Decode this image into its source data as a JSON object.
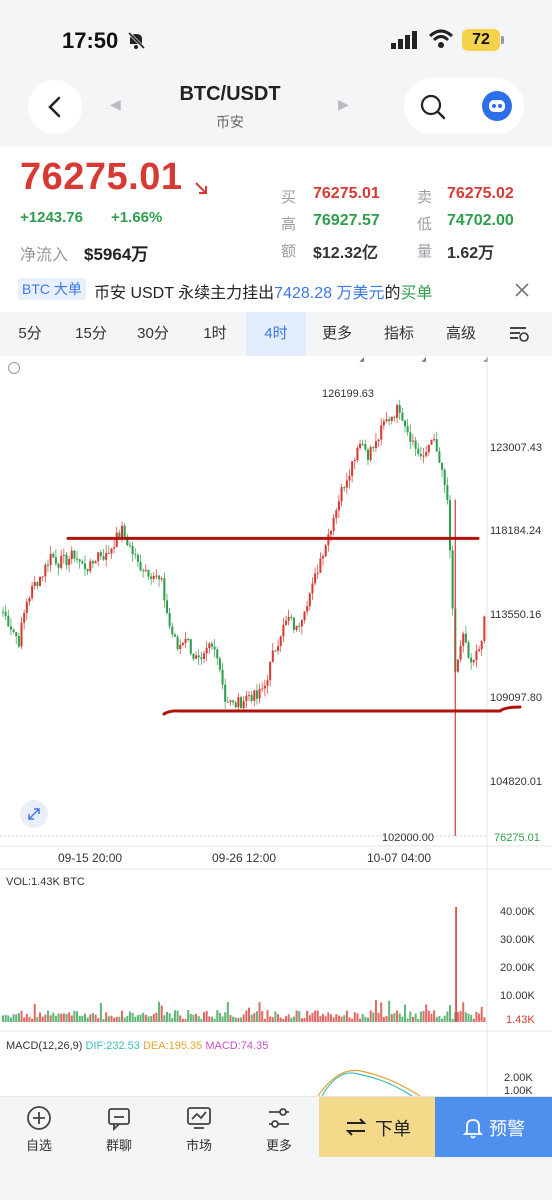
{
  "status": {
    "time": "17:50",
    "battery": "72"
  },
  "header": {
    "pair": "BTC/USDT",
    "exchange": "币安"
  },
  "price": {
    "last": "76275.01",
    "change_abs": "+1243.76",
    "change_pct": "+1.66%",
    "net_inflow_label": "净流入",
    "net_inflow_value": "$5964万"
  },
  "stats": {
    "buy_label": "买",
    "buy_value": "76275.01",
    "sell_label": "卖",
    "sell_value": "76275.02",
    "high_label": "高",
    "high_value": "76927.57",
    "low_label": "低",
    "low_value": "74702.00",
    "amount_label": "额",
    "amount_value": "$12.32亿",
    "volume_label": "量",
    "volume_value": "1.62万"
  },
  "news": {
    "tag": "BTC 大单",
    "prefix": "币安 USDT 永续主力挂出",
    "amount": "7428.28 万美元",
    "middle": "的",
    "side": "买单"
  },
  "tabs": [
    {
      "label": "5分"
    },
    {
      "label": "15分"
    },
    {
      "label": "30分"
    },
    {
      "label": "1时"
    },
    {
      "label": "4时"
    },
    {
      "label": "更多"
    },
    {
      "label": "指标"
    },
    {
      "label": "高级"
    }
  ],
  "chart_data": {
    "type": "candlestick",
    "y_axis_labels": [
      "123007.43",
      "118184.24",
      "113550.16",
      "109097.80",
      "104820.01"
    ],
    "x_axis_labels": [
      "09-15 20:00",
      "09-26 12:00",
      "10-07 04:00"
    ],
    "max_label": "126199.63",
    "min_label": "102000.00",
    "last_price_label": "76275.01",
    "ylim": [
      102000,
      126199.63
    ],
    "close_path": [
      114200,
      113400,
      112600,
      114800,
      115700,
      116300,
      117300,
      116900,
      117000,
      117300,
      116700,
      116600,
      117400,
      117200,
      118000,
      118600,
      117700,
      116800,
      116500,
      116200,
      115700,
      113400,
      112200,
      112900,
      111800,
      111300,
      112300,
      112000,
      109500,
      109100,
      109300,
      109700,
      109500,
      110200,
      111800,
      113100,
      113800,
      113200,
      114500,
      115500,
      117100,
      118400,
      119900,
      121200,
      122300,
      123600,
      122800,
      123300,
      124400,
      124900,
      125300,
      124100,
      123100,
      122400,
      123800,
      122300,
      120300,
      111000,
      112800,
      111100,
      112200,
      114300
    ],
    "drawn_lines": [
      {
        "name": "resistance",
        "y": 118184
      },
      {
        "name": "support",
        "y": 108740
      }
    ],
    "volume": {
      "title": "VOL:1.43K BTC",
      "y_axis_labels": [
        "40.00K",
        "30.00K",
        "20.00K",
        "10.00K"
      ],
      "last_label": "1.43K"
    },
    "macd": {
      "title": "MACD(12,26,9)",
      "dif": "DIF:232.53",
      "dea": "DEA:195.35",
      "macd": "MACD:74.35",
      "y_axis_labels": [
        "2.00K",
        "1.00K"
      ]
    }
  },
  "bottom_nav": [
    {
      "label": "自选"
    },
    {
      "label": "群聊"
    },
    {
      "label": "市场"
    },
    {
      "label": "更多"
    }
  ],
  "actions": {
    "order": "下单",
    "alert": "预警"
  },
  "colors": {
    "up": "#d63a32",
    "down": "#2f9e4c",
    "accent": "#3d79e4",
    "line": "#b0130a"
  }
}
